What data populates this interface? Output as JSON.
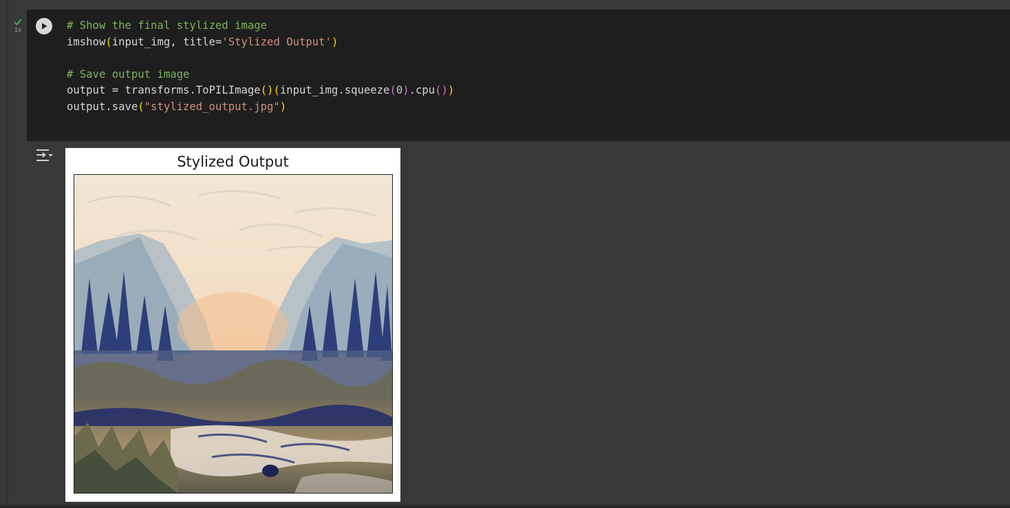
{
  "cell": {
    "exec_time": "1s",
    "code": {
      "line1_comment": "# Show the final stylized image",
      "line2": {
        "func": "imshow",
        "open": "(",
        "args": "input_img, title=",
        "title_str": "'Stylized Output'",
        "close": ")"
      },
      "line4_comment": "# Save output image",
      "line5": {
        "lhs": "output = transforms.ToPILImage",
        "p1": "()",
        "p2_open": "(",
        "mid": "input_img.squeeze",
        "p3_open": "(",
        "num": "0",
        "p3_close": ")",
        "cpu": ".cpu",
        "p4": "()",
        "p2_close": ")"
      },
      "line6": {
        "call": "output.save",
        "open": "(",
        "str": "\"stylized_output.jpg\"",
        "close": ")"
      }
    }
  },
  "output": {
    "figure_title": "Stylized Output"
  },
  "icons": {
    "check": "check-icon",
    "run": "play-icon",
    "output_toggle": "output-collapse-icon"
  },
  "colors": {
    "editor_bg": "#1e1e1e",
    "page_bg": "#383838",
    "comment": "#7fb35a",
    "string": "#ce9178",
    "paren": "#ffd700"
  }
}
